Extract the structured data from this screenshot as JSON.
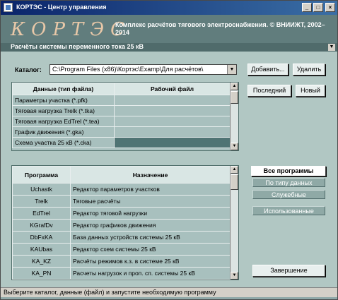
{
  "window": {
    "title": "КОРТЭС - Центр управления"
  },
  "banner": {
    "logo": "КОРТЭС",
    "subtitle": "Комплекс расчётов тягового электроснабжения. © ВНИИЖТ, 2002–2014"
  },
  "mode": {
    "label": "Расчёты системы переменного тока 25 кВ"
  },
  "catalog": {
    "label": "Каталог:",
    "path": "C:\\Program Files (x86)\\Кортэс\\Examp\\Для расчётов\\",
    "add_label": "Добавить...",
    "delete_label": "Удалить",
    "last_label": "Последний",
    "new_label": "Новый"
  },
  "files": {
    "headers": [
      "Данные (тип файла)",
      "Рабочий файл"
    ],
    "rows": [
      {
        "type": "Параметры участка  (*.pfk)",
        "file": ""
      },
      {
        "type": "Тяговая нагрузка Trelk  (*.tka)",
        "file": ""
      },
      {
        "type": "Тяговая нагрузка EdTrel  (*.tea)",
        "file": ""
      },
      {
        "type": "График движения  (*.gka)",
        "file": ""
      },
      {
        "type": "Схема участка 25 кВ  (*.cka)",
        "file": ""
      }
    ]
  },
  "programs": {
    "headers": [
      "Программа",
      "Назначение"
    ],
    "rows": [
      {
        "name": "Uchastk",
        "purpose": "Редактор параметров участков"
      },
      {
        "name": "Trelk",
        "purpose": "Тяговые расчёты"
      },
      {
        "name": "EdTrel",
        "purpose": "Редактор тяговой нагрузки"
      },
      {
        "name": "KGrafDv",
        "purpose": "Редактор графиков движения"
      },
      {
        "name": "DbFxKA",
        "purpose": "База данных устройств системы 25 кВ"
      },
      {
        "name": "KAUbas",
        "purpose": "Редактор схем системы 25 кВ"
      },
      {
        "name": "KA_KZ",
        "purpose": "Расчёты режимов к.з. в системе 25 кВ"
      },
      {
        "name": "KA_PN",
        "purpose": "Расчеты нагрузок и проп. сп. системы 25 кВ"
      }
    ]
  },
  "filters": {
    "all": "Все программы",
    "by_type": "По типу данных",
    "service": "Служебные",
    "used": "Использованные"
  },
  "finish_label": "Завершение",
  "status": {
    "text": "Выберите каталог,  данные (файл) и запустите необходимую программу"
  }
}
